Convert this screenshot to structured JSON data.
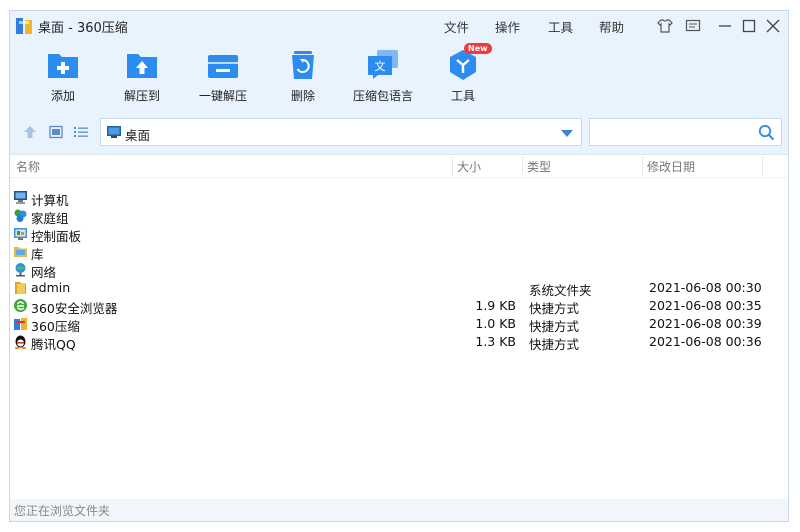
{
  "window": {
    "title": "桌面 - 360压缩"
  },
  "menu": {
    "file": "文件",
    "operate": "操作",
    "tools": "工具",
    "help": "帮助"
  },
  "toolbar": {
    "add": "添加",
    "extract_to": "解压到",
    "one_click_extract": "一键解压",
    "delete": "删除",
    "archive_language": "压缩包语言",
    "tools": "工具",
    "new_badge": "New"
  },
  "address": {
    "path": "桌面"
  },
  "search": {
    "value": "",
    "placeholder": ""
  },
  "columns": {
    "name": "名称",
    "size": "大小",
    "type": "类型",
    "modified": "修改日期"
  },
  "files": [
    {
      "name": "计算机",
      "size": "",
      "type": "",
      "modified": "",
      "icon": "computer-icon"
    },
    {
      "name": "家庭组",
      "size": "",
      "type": "",
      "modified": "",
      "icon": "homegroup-icon"
    },
    {
      "name": "控制面板",
      "size": "",
      "type": "",
      "modified": "",
      "icon": "control-panel-icon"
    },
    {
      "name": "库",
      "size": "",
      "type": "",
      "modified": "",
      "icon": "library-icon"
    },
    {
      "name": "网络",
      "size": "",
      "type": "",
      "modified": "",
      "icon": "network-icon"
    },
    {
      "name": "admin",
      "size": "",
      "type": "系统文件夹",
      "modified": "2021-06-08 00:30",
      "icon": "folder-icon"
    },
    {
      "name": "360安全浏览器",
      "size": "1.9 KB",
      "type": "快捷方式",
      "modified": "2021-06-08 00:35",
      "icon": "browser-icon"
    },
    {
      "name": "360压缩",
      "size": "1.0 KB",
      "type": "快捷方式",
      "modified": "2021-06-08 00:39",
      "icon": "archive-app-icon"
    },
    {
      "name": "腾讯QQ",
      "size": "1.3 KB",
      "type": "快捷方式",
      "modified": "2021-06-08 00:36",
      "icon": "qq-icon"
    }
  ],
  "status": {
    "text": "您正在浏览文件夹"
  },
  "colors": {
    "accent": "#2d8cf0",
    "window_bg": "#e9f3fd",
    "badge": "#ef3b3b"
  }
}
